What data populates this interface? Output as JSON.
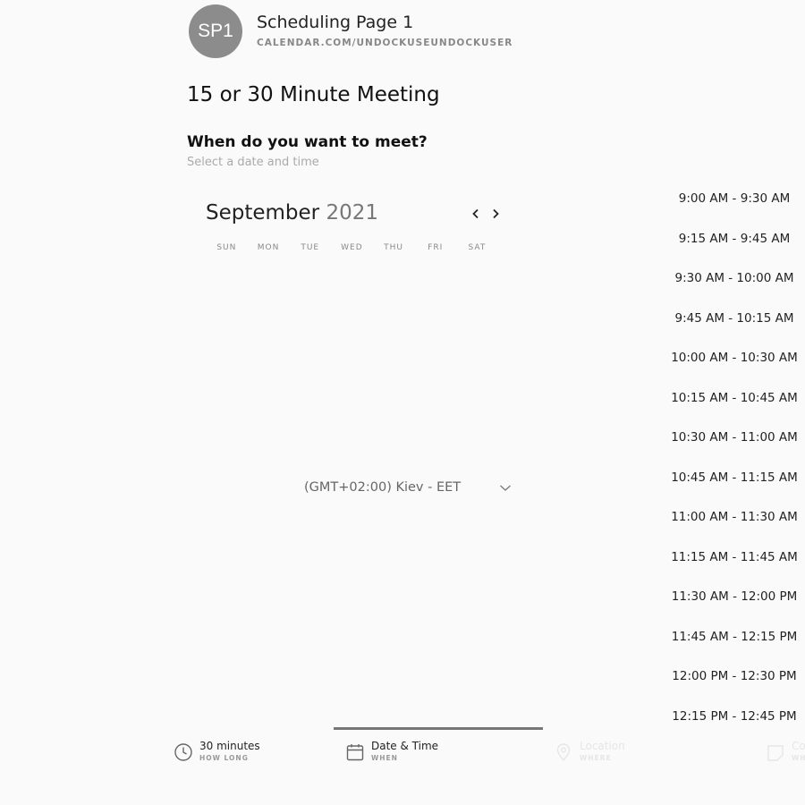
{
  "header": {
    "avatar_initials": "SP1",
    "page_name": "Scheduling Page 1",
    "page_url": "CALENDAR.COM/UNDOCKUSEUNDOCKUSER"
  },
  "event": {
    "title": "15 or 30 Minute Meeting",
    "question": "When do you want to meet?",
    "instruction": "Select a date and time"
  },
  "calendar": {
    "month": "September",
    "year": "2021",
    "prev_icon": "chevron-left-icon",
    "next_icon": "chevron-right-icon",
    "weekdays": [
      "SUN",
      "MON",
      "TUE",
      "WED",
      "THU",
      "FRI",
      "SAT"
    ]
  },
  "timezone": {
    "value": "(GMT+02:00) Kiev - EET",
    "icon": "chevron-down-icon"
  },
  "slots": [
    "9:00 AM - 9:30 AM",
    "9:15 AM - 9:45 AM",
    "9:30 AM - 10:00 AM",
    "9:45 AM - 10:15 AM",
    "10:00 AM - 10:30 AM",
    "10:15 AM - 10:45 AM",
    "10:30 AM - 11:00 AM",
    "10:45 AM - 11:15 AM",
    "11:00 AM - 11:30 AM",
    "11:15 AM - 11:45 AM",
    "11:30 AM - 12:00 PM",
    "11:45 AM - 12:15 PM",
    "12:00 PM - 12:30 PM",
    "12:15 PM - 12:45 PM"
  ],
  "steps": [
    {
      "label": "30 minutes",
      "sub": "HOW LONG",
      "icon": "clock-icon"
    },
    {
      "label": "Date & Time",
      "sub": "WHEN",
      "icon": "calendar-icon"
    },
    {
      "label": "Location",
      "sub": "WHERE",
      "icon": "location-pin-icon"
    },
    {
      "label": "Co",
      "sub": "WH",
      "icon": "note-icon"
    }
  ],
  "colors": {
    "background": "#fafafa",
    "avatar": "#8c8c8c",
    "active_step_bar": "#777777"
  }
}
